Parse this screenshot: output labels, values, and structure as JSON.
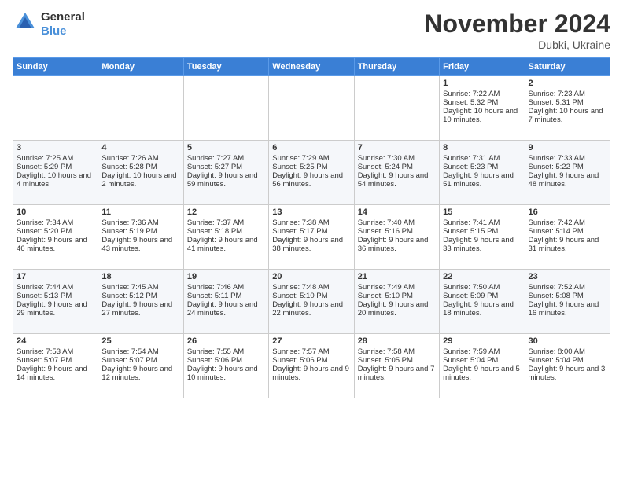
{
  "logo": {
    "general": "General",
    "blue": "Blue"
  },
  "header": {
    "title": "November 2024",
    "subtitle": "Dubki, Ukraine"
  },
  "columns": [
    "Sunday",
    "Monday",
    "Tuesday",
    "Wednesday",
    "Thursday",
    "Friday",
    "Saturday"
  ],
  "weeks": [
    [
      {
        "day": "",
        "content": ""
      },
      {
        "day": "",
        "content": ""
      },
      {
        "day": "",
        "content": ""
      },
      {
        "day": "",
        "content": ""
      },
      {
        "day": "",
        "content": ""
      },
      {
        "day": "1",
        "content": "Sunrise: 7:22 AM\nSunset: 5:32 PM\nDaylight: 10 hours and 10 minutes."
      },
      {
        "day": "2",
        "content": "Sunrise: 7:23 AM\nSunset: 5:31 PM\nDaylight: 10 hours and 7 minutes."
      }
    ],
    [
      {
        "day": "3",
        "content": "Sunrise: 7:25 AM\nSunset: 5:29 PM\nDaylight: 10 hours and 4 minutes."
      },
      {
        "day": "4",
        "content": "Sunrise: 7:26 AM\nSunset: 5:28 PM\nDaylight: 10 hours and 2 minutes."
      },
      {
        "day": "5",
        "content": "Sunrise: 7:27 AM\nSunset: 5:27 PM\nDaylight: 9 hours and 59 minutes."
      },
      {
        "day": "6",
        "content": "Sunrise: 7:29 AM\nSunset: 5:25 PM\nDaylight: 9 hours and 56 minutes."
      },
      {
        "day": "7",
        "content": "Sunrise: 7:30 AM\nSunset: 5:24 PM\nDaylight: 9 hours and 54 minutes."
      },
      {
        "day": "8",
        "content": "Sunrise: 7:31 AM\nSunset: 5:23 PM\nDaylight: 9 hours and 51 minutes."
      },
      {
        "day": "9",
        "content": "Sunrise: 7:33 AM\nSunset: 5:22 PM\nDaylight: 9 hours and 48 minutes."
      }
    ],
    [
      {
        "day": "10",
        "content": "Sunrise: 7:34 AM\nSunset: 5:20 PM\nDaylight: 9 hours and 46 minutes."
      },
      {
        "day": "11",
        "content": "Sunrise: 7:36 AM\nSunset: 5:19 PM\nDaylight: 9 hours and 43 minutes."
      },
      {
        "day": "12",
        "content": "Sunrise: 7:37 AM\nSunset: 5:18 PM\nDaylight: 9 hours and 41 minutes."
      },
      {
        "day": "13",
        "content": "Sunrise: 7:38 AM\nSunset: 5:17 PM\nDaylight: 9 hours and 38 minutes."
      },
      {
        "day": "14",
        "content": "Sunrise: 7:40 AM\nSunset: 5:16 PM\nDaylight: 9 hours and 36 minutes."
      },
      {
        "day": "15",
        "content": "Sunrise: 7:41 AM\nSunset: 5:15 PM\nDaylight: 9 hours and 33 minutes."
      },
      {
        "day": "16",
        "content": "Sunrise: 7:42 AM\nSunset: 5:14 PM\nDaylight: 9 hours and 31 minutes."
      }
    ],
    [
      {
        "day": "17",
        "content": "Sunrise: 7:44 AM\nSunset: 5:13 PM\nDaylight: 9 hours and 29 minutes."
      },
      {
        "day": "18",
        "content": "Sunrise: 7:45 AM\nSunset: 5:12 PM\nDaylight: 9 hours and 27 minutes."
      },
      {
        "day": "19",
        "content": "Sunrise: 7:46 AM\nSunset: 5:11 PM\nDaylight: 9 hours and 24 minutes."
      },
      {
        "day": "20",
        "content": "Sunrise: 7:48 AM\nSunset: 5:10 PM\nDaylight: 9 hours and 22 minutes."
      },
      {
        "day": "21",
        "content": "Sunrise: 7:49 AM\nSunset: 5:10 PM\nDaylight: 9 hours and 20 minutes."
      },
      {
        "day": "22",
        "content": "Sunrise: 7:50 AM\nSunset: 5:09 PM\nDaylight: 9 hours and 18 minutes."
      },
      {
        "day": "23",
        "content": "Sunrise: 7:52 AM\nSunset: 5:08 PM\nDaylight: 9 hours and 16 minutes."
      }
    ],
    [
      {
        "day": "24",
        "content": "Sunrise: 7:53 AM\nSunset: 5:07 PM\nDaylight: 9 hours and 14 minutes."
      },
      {
        "day": "25",
        "content": "Sunrise: 7:54 AM\nSunset: 5:07 PM\nDaylight: 9 hours and 12 minutes."
      },
      {
        "day": "26",
        "content": "Sunrise: 7:55 AM\nSunset: 5:06 PM\nDaylight: 9 hours and 10 minutes."
      },
      {
        "day": "27",
        "content": "Sunrise: 7:57 AM\nSunset: 5:06 PM\nDaylight: 9 hours and 9 minutes."
      },
      {
        "day": "28",
        "content": "Sunrise: 7:58 AM\nSunset: 5:05 PM\nDaylight: 9 hours and 7 minutes."
      },
      {
        "day": "29",
        "content": "Sunrise: 7:59 AM\nSunset: 5:04 PM\nDaylight: 9 hours and 5 minutes."
      },
      {
        "day": "30",
        "content": "Sunrise: 8:00 AM\nSunset: 5:04 PM\nDaylight: 9 hours and 3 minutes."
      }
    ]
  ]
}
